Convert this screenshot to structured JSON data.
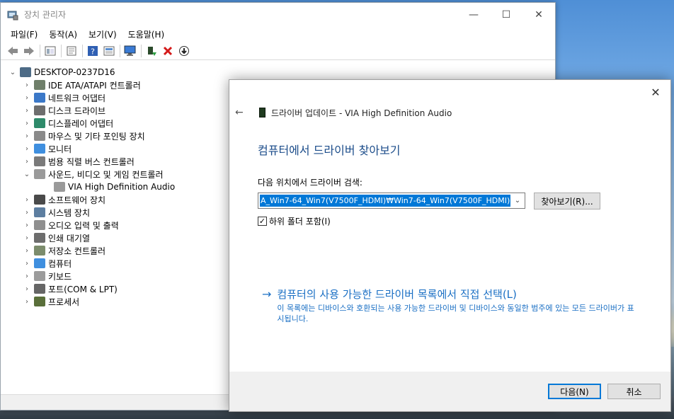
{
  "window": {
    "title": "장치 관리자",
    "controls": {
      "minimize": "—",
      "maximize": "☐",
      "close": "✕"
    }
  },
  "menu": [
    "파일(F)",
    "동작(A)",
    "보기(V)",
    "도움말(H)"
  ],
  "toolbar": {
    "icons": [
      "back-icon",
      "forward-icon",
      "show-hide-icon",
      "properties-icon",
      "help-icon",
      "view-icon",
      "monitor-scan-icon",
      "update-driver-icon",
      "uninstall-icon",
      "disable-icon"
    ]
  },
  "tree": {
    "root": "DESKTOP-0237D16",
    "items": [
      {
        "label": "IDE ATA/ATAPI 컨트롤러",
        "expander": "›",
        "icon": "ide-icon"
      },
      {
        "label": "네트워크 어댑터",
        "expander": "›",
        "icon": "network-icon"
      },
      {
        "label": "디스크 드라이브",
        "expander": "›",
        "icon": "disk-icon"
      },
      {
        "label": "디스플레이 어댑터",
        "expander": "›",
        "icon": "display-adapter-icon"
      },
      {
        "label": "마우스 및 기타 포인팅 장치",
        "expander": "›",
        "icon": "mouse-icon"
      },
      {
        "label": "모니터",
        "expander": "›",
        "icon": "monitor-icon"
      },
      {
        "label": "범용 직렬 버스 컨트롤러",
        "expander": "›",
        "icon": "usb-icon"
      },
      {
        "label": "사운드, 비디오 및 게임 컨트롤러",
        "expander": "⌄",
        "icon": "speaker-icon"
      },
      {
        "label": "VIA High Definition Audio",
        "expander": "",
        "icon": "speaker-icon"
      },
      {
        "label": "소프트웨어 장치",
        "expander": "›",
        "icon": "software-icon"
      },
      {
        "label": "시스템 장치",
        "expander": "›",
        "icon": "system-icon"
      },
      {
        "label": "오디오 입력 및 출력",
        "expander": "›",
        "icon": "audio-icon"
      },
      {
        "label": "인쇄 대기열",
        "expander": "›",
        "icon": "printer-icon"
      },
      {
        "label": "저장소 컨트롤러",
        "expander": "›",
        "icon": "storage-icon"
      },
      {
        "label": "컴퓨터",
        "expander": "›",
        "icon": "computer-icon"
      },
      {
        "label": "키보드",
        "expander": "›",
        "icon": "keyboard-icon"
      },
      {
        "label": "포트(COM & LPT)",
        "expander": "›",
        "icon": "port-icon"
      },
      {
        "label": "프로세서",
        "expander": "›",
        "icon": "processor-icon"
      }
    ]
  },
  "dialog": {
    "close": "✕",
    "back": "←",
    "header": "드라이버 업데이트 - VIA High Definition Audio",
    "main_title": "컴퓨터에서 드라이버 찾아보기",
    "search_label": "다음 위치에서 드라이버 검색:",
    "path_value": "A_Win7-64_Win7(V7500F_HDMI)\\Win7-64_Win7(V7500F_HDMI)",
    "path_display": "A_Win7-64_Win7(V7500F_HDMI)₩Win7-64_Win7(V7500F_HDMI)",
    "combo_arrow": "⌄",
    "browse_button": "찾아보기(R)...",
    "include_subfolders": "하위 폴더 포함(I)",
    "include_checked": true,
    "check_mark": "✓",
    "link_arrow": "→",
    "link_title": "컴퓨터의 사용 가능한 드라이버 목록에서 직접 선택(L)",
    "link_desc": "이 목록에는 디바이스와 호환되는 사용 가능한 드라이버 및 디바이스와 동일한 범주에 있는 모든 드라이버가 표시됩니다.",
    "next_button": "다음(N)",
    "cancel_button": "취소"
  }
}
